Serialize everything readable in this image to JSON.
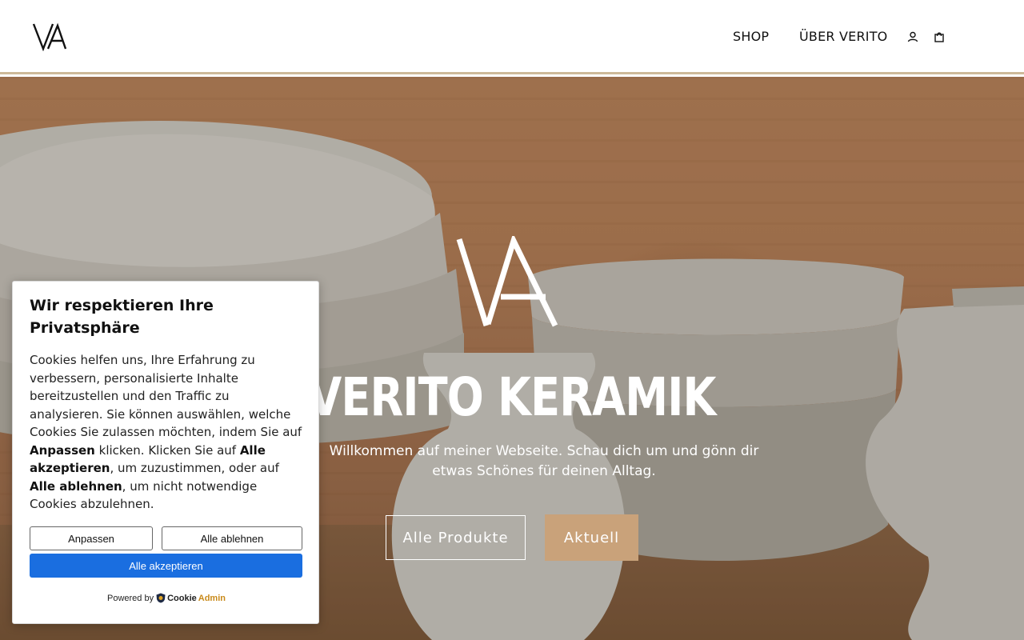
{
  "header": {
    "logo_text": "VA",
    "nav": [
      {
        "label": "SHOP"
      },
      {
        "label": "ÜBER VERITO"
      }
    ],
    "icons": [
      "user-icon",
      "shopping-bag-icon"
    ]
  },
  "hero": {
    "logo_text": "VA",
    "title": "VERITO KERAMIK",
    "subtitle": "Willkommen auf meiner Webseite. Schau dich um und gönn dir etwas Schönes für deinen Alltag.",
    "buttons": {
      "products": "Alle Produkte",
      "current": "Aktuell"
    },
    "accent_color": "#c9a27a"
  },
  "cookie": {
    "title": "Wir respektieren Ihre Privatsphäre",
    "text_1": "Cookies helfen uns, Ihre Erfahrung zu verbessern, personalisierte Inhalte bereitzustellen und den Traffic zu analysieren. Sie können auswählen, welche Cookies Sie zulassen möchten, indem Sie auf ",
    "bold_1": "Anpassen",
    "text_2": " klicken. Klicken Sie auf ",
    "bold_2": "Alle akzeptieren",
    "text_3": ", um zuzustimmen, oder auf ",
    "bold_3": "Alle ablehnen",
    "text_4": ", um nicht notwendige Cookies abzulehnen.",
    "buttons": {
      "customize": "Anpassen",
      "reject": "Alle ablehnen",
      "accept": "Alle akzeptieren"
    },
    "powered_by": "Powered by",
    "brand_cookie": "Cookie",
    "brand_admin": "Admin",
    "accept_color": "#1a6ee0"
  }
}
